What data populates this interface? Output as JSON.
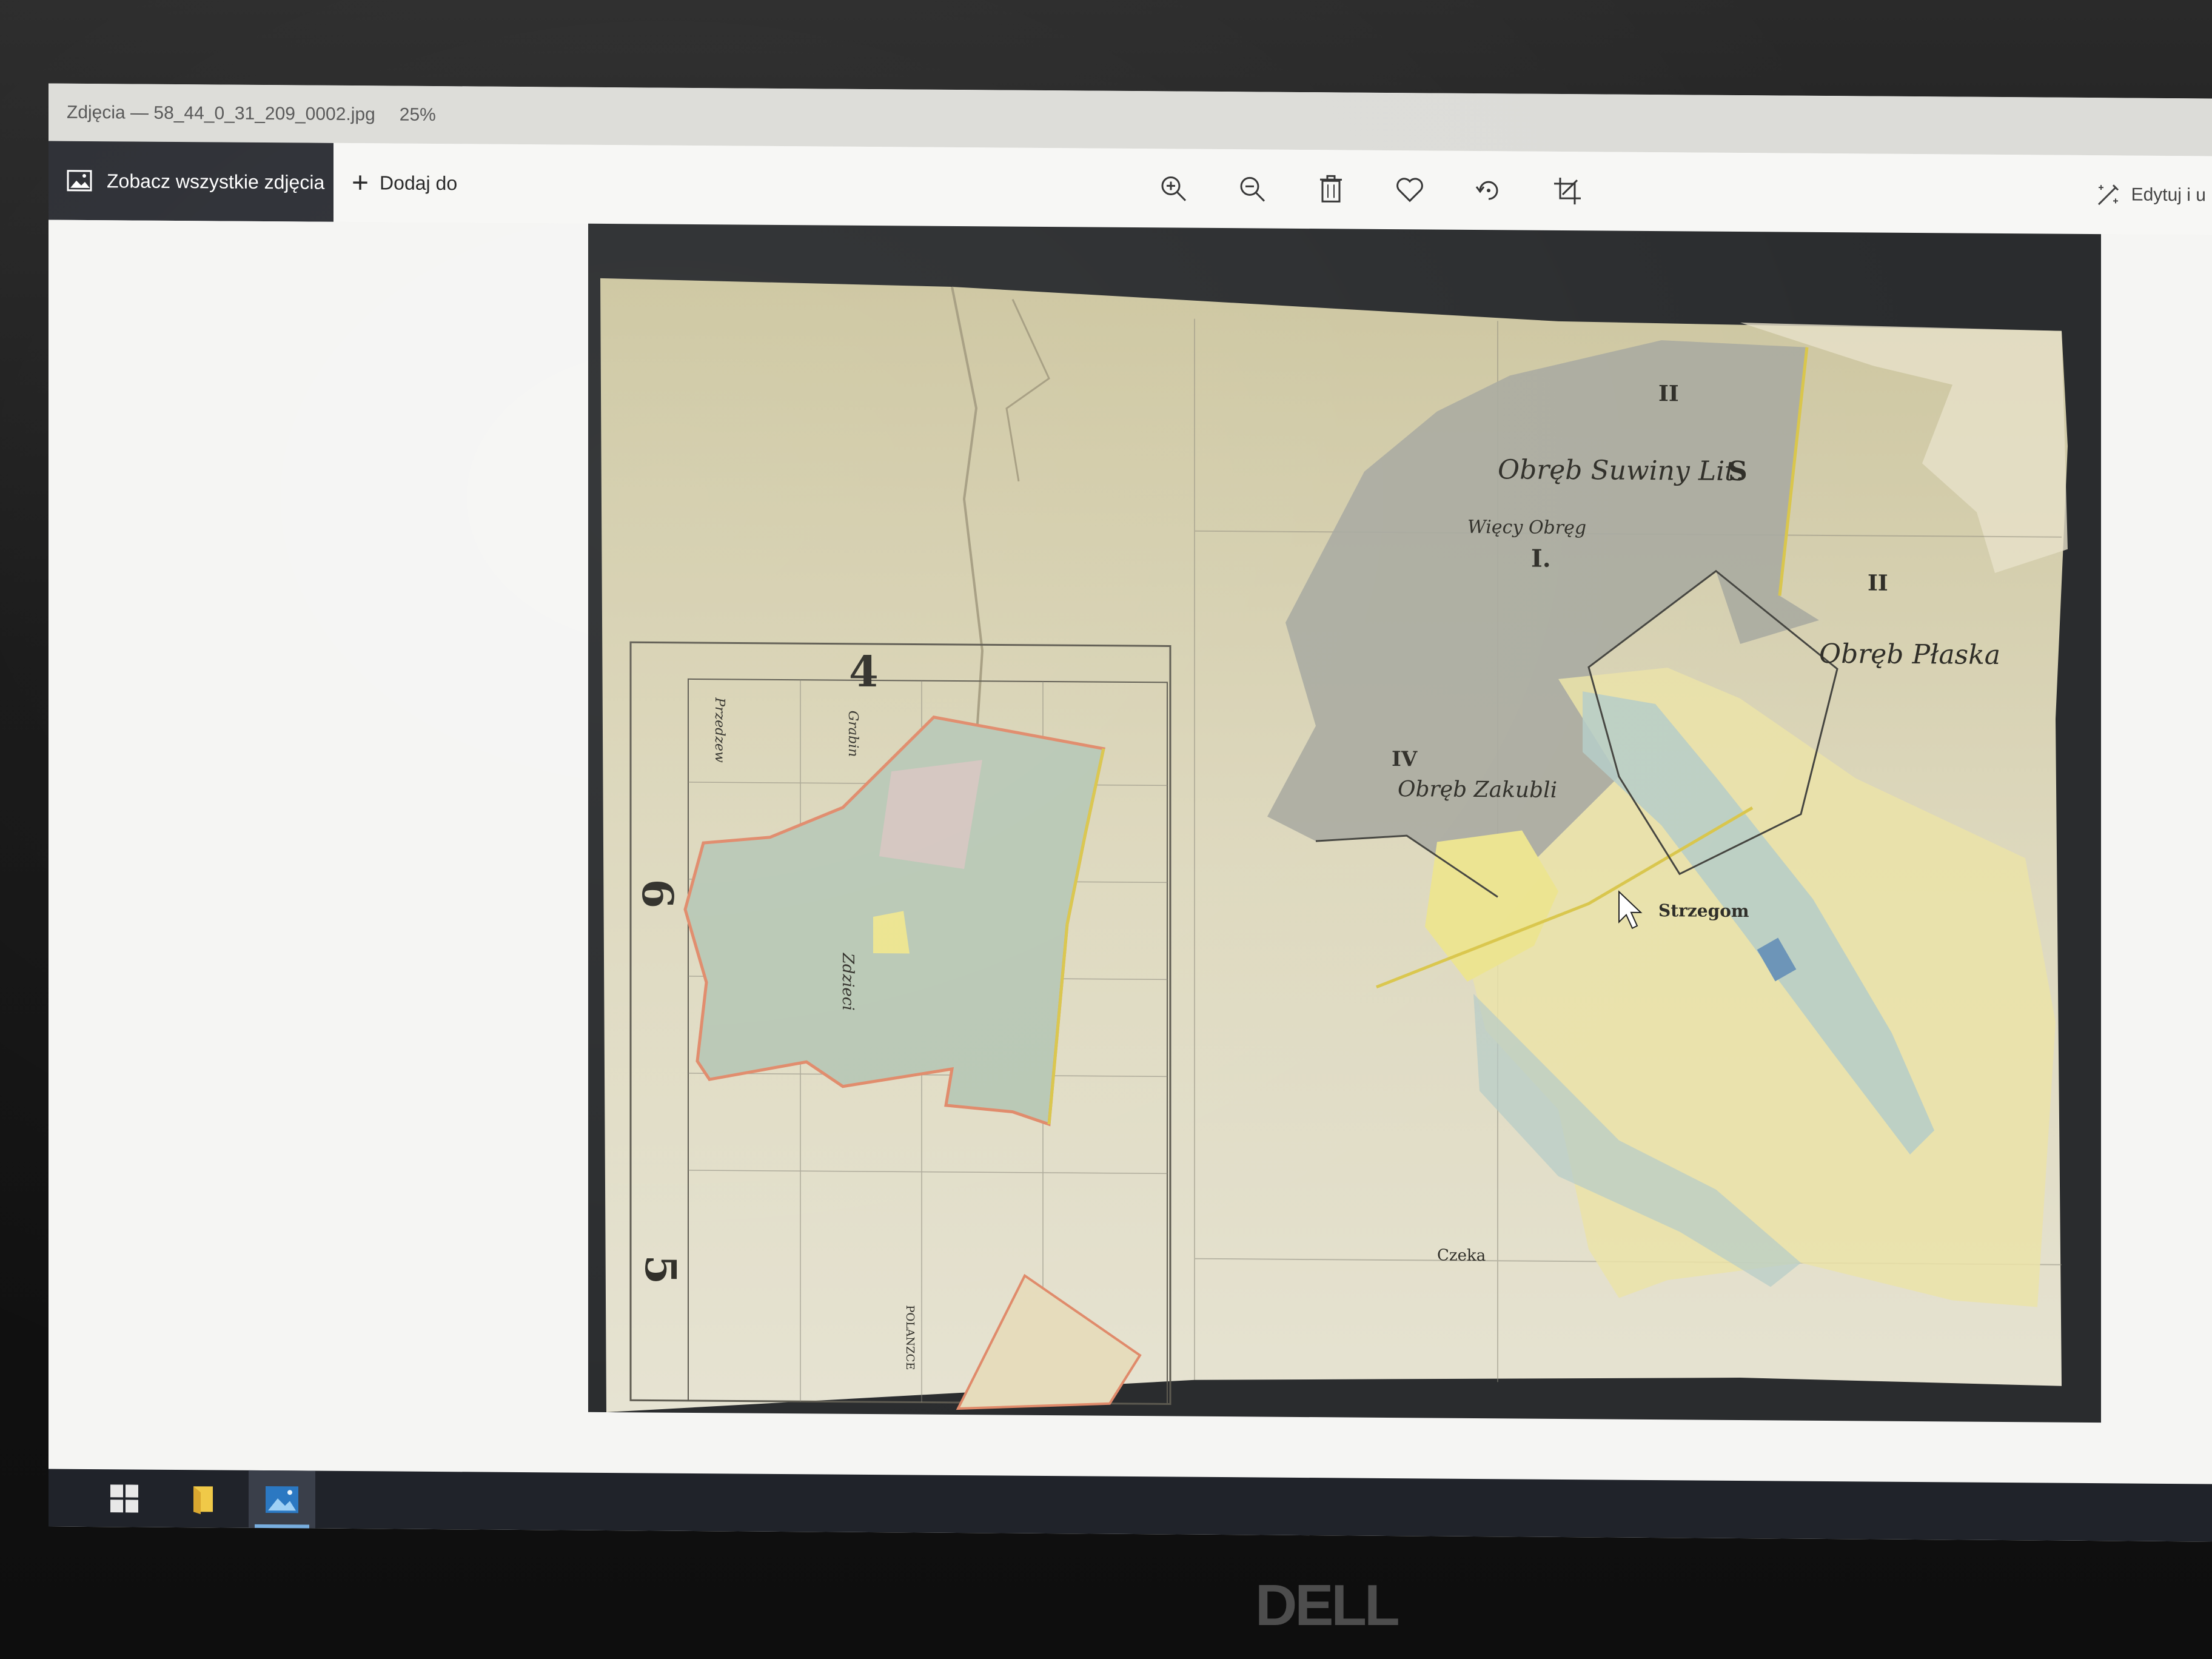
{
  "window": {
    "title": "Zdjęcia — 58_44_0_31_209_0002.jpg",
    "zoom": "25%"
  },
  "toolbar": {
    "all_photos_label": "Zobacz wszystkie zdjęcia",
    "add_to_label": "Dodaj do",
    "edit_label": "Edytuj i u",
    "tools": [
      "zoom-in-icon",
      "zoom-out-icon",
      "delete-icon",
      "favorite-icon",
      "rotate-icon",
      "crop-icon"
    ]
  },
  "map_labels": {
    "numeral_4": "4",
    "numeral_6": "6",
    "numeral_5": "5",
    "obreb_suwiny": "Obręb Suwiny Lit.",
    "letter_s": "S",
    "obreb_plaska": "Obręb Płaska",
    "roman_II_a": "II",
    "roman_II_b": "II",
    "roman_I": "I.",
    "roman_IV": "IV",
    "obreb_zakubli": "Obręb Zakubli",
    "wiecy_obreg": "Więcy Obręg",
    "strzegom": "Strzegom",
    "czeka": "Czeka",
    "zdzieci": "Zdzieci",
    "przedzew": "Przedzew",
    "grubin": "Grabin",
    "polanzce": "POLANZCE"
  },
  "colors": {
    "paper": "#ddd6b8",
    "gray_region": "#a9aaa0",
    "yellow_region": "#ece490",
    "blue_tint": "#b5ccc8",
    "boundary_red": "#e08a6a"
  },
  "taskbar": {
    "items": [
      "windows-start-icon",
      "file-explorer-icon",
      "photos-app-icon"
    ]
  },
  "brand": "DELL"
}
